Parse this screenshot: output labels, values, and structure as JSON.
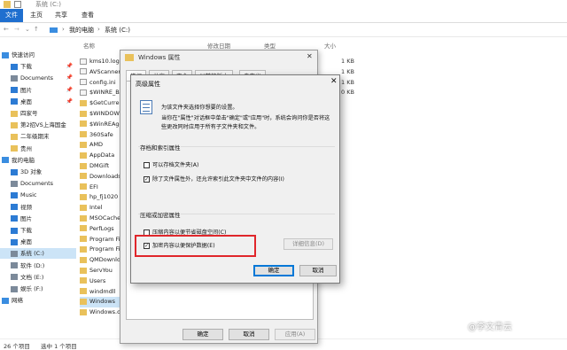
{
  "titlebar": {
    "title": "系统 (C:)"
  },
  "ribbon": {
    "tabs": [
      "文件",
      "主页",
      "共享",
      "查看"
    ]
  },
  "address": {
    "path": [
      "我的电脑",
      "系统 (C:)"
    ]
  },
  "nav": {
    "items": [
      {
        "label": "快速访问",
        "icon": "star-icon"
      },
      {
        "label": "下载",
        "icon": "download-icon",
        "pinned": true
      },
      {
        "label": "Documents",
        "icon": "document-icon",
        "pinned": true
      },
      {
        "label": "图片",
        "icon": "picture-icon",
        "pinned": true
      },
      {
        "label": "桌面",
        "icon": "desktop-icon",
        "pinned": true
      },
      {
        "label": "四家号",
        "icon": "folder-icon"
      },
      {
        "label": "第2招VS上海国金",
        "icon": "folder-icon"
      },
      {
        "label": "二年级期末",
        "icon": "folder-icon"
      },
      {
        "label": "贵州",
        "icon": "folder-icon"
      },
      {
        "label": "我的电脑",
        "icon": "computer-icon"
      },
      {
        "label": "3D 对象",
        "icon": "cube-icon"
      },
      {
        "label": "Documents",
        "icon": "document-icon"
      },
      {
        "label": "Music",
        "icon": "music-icon"
      },
      {
        "label": "视频",
        "icon": "video-icon"
      },
      {
        "label": "图片",
        "icon": "picture-icon"
      },
      {
        "label": "下载",
        "icon": "download-icon"
      },
      {
        "label": "桌面",
        "icon": "desktop-icon"
      },
      {
        "label": "系统 (C:)",
        "icon": "drive-icon",
        "selected": true
      },
      {
        "label": "软件 (D:)",
        "icon": "drive-icon"
      },
      {
        "label": "文档 (E:)",
        "icon": "drive-icon"
      },
      {
        "label": "娱乐 (F:)",
        "icon": "drive-icon"
      },
      {
        "label": "网络",
        "icon": "network-icon"
      }
    ]
  },
  "list": {
    "headers": {
      "name": "名称",
      "modified": "修改日期",
      "type": "类型",
      "size": "大小"
    },
    "files": [
      {
        "name": "kms10.log",
        "size": "1 KB"
      },
      {
        "name": "AVScanner.ini",
        "size": "1 KB"
      },
      {
        "name": "config.ini",
        "size": "1 KB"
      },
      {
        "name": "$WINRE_BACKUP_PARTITION.MARKER",
        "size": "0 KB"
      },
      {
        "name": "$GetCurrent"
      },
      {
        "name": "$WINDOWS.~WS"
      },
      {
        "name": "$WinREAgent"
      },
      {
        "name": "360Safe"
      },
      {
        "name": "AMD"
      },
      {
        "name": "AppData"
      },
      {
        "name": "DMGift"
      },
      {
        "name": "Downloads"
      },
      {
        "name": "EFI"
      },
      {
        "name": "hp_fj1020"
      },
      {
        "name": "Intel"
      },
      {
        "name": "MSOCache"
      },
      {
        "name": "PerfLogs"
      },
      {
        "name": "Program Files"
      },
      {
        "name": "Program Files (x86)"
      },
      {
        "name": "QMDownload"
      },
      {
        "name": "ServYou"
      },
      {
        "name": "Users"
      },
      {
        "name": "windmdll"
      },
      {
        "name": "Windows",
        "selected": true
      },
      {
        "name": "Windows.old"
      }
    ]
  },
  "status": {
    "count": "26 个项目",
    "selected": "选中 1 个项目"
  },
  "props_dialog": {
    "title": "Windows 属性",
    "tabs": [
      "常规",
      "共享",
      "安全",
      "以前的版本",
      "自定义"
    ],
    "ok": "确定",
    "cancel": "取消",
    "apply": "应用(A)"
  },
  "adv_dialog": {
    "title": "高级属性",
    "description": "为该文件夹选择你想要的设置。",
    "description2": "当你在\"属性\"对话框中单击\"确定\"或\"应用\"时，系统会询问你是否将这些更改同时应用于所有子文件夹和文件。",
    "group1": "存档和索引属性",
    "archive": "可以存档文件夹(A)",
    "index": "除了文件属性外，还允许索引此文件夹中文件的内容(I)",
    "group2": "压缩或加密属性",
    "compress": "压缩内容以便节省磁盘空间(C)",
    "encrypt": "加密内容以便保护数据(E)",
    "details": "详细信息(D)",
    "ok": "确定",
    "cancel": "取消"
  },
  "watermark": "@李文青云"
}
